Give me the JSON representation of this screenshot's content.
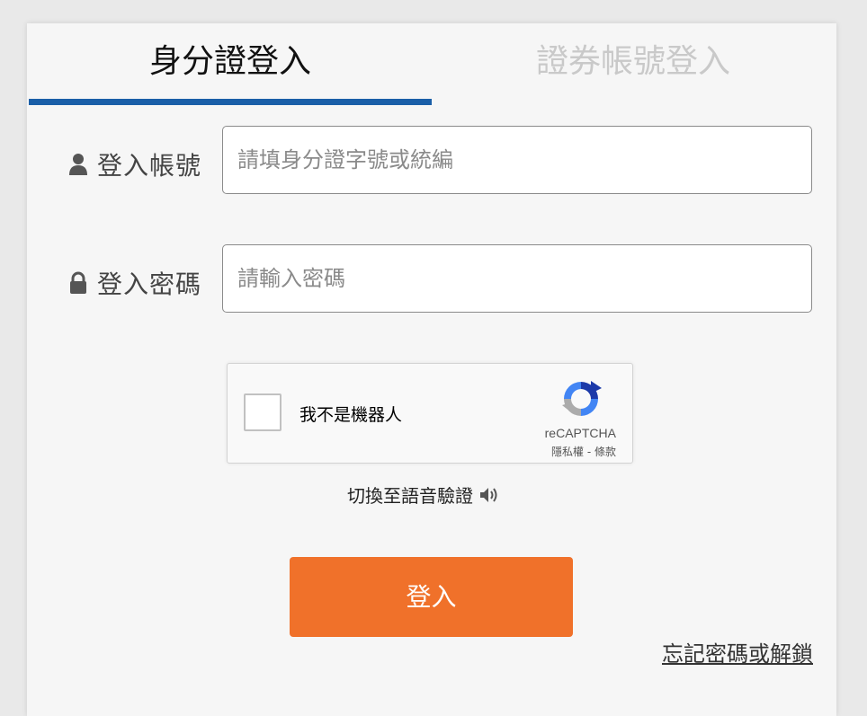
{
  "tabs": {
    "id_login": "身分證登入",
    "broker_login": "證券帳號登入"
  },
  "account": {
    "label": "登入帳號",
    "placeholder": "請填身分證字號或統編",
    "icon": "user-icon"
  },
  "password": {
    "label": "登入密碼",
    "placeholder": "請輸入密碼",
    "icon": "lock-icon"
  },
  "captcha": {
    "label": "我不是機器人",
    "brand": "reCAPTCHA",
    "terms": "隱私權 - 條款"
  },
  "audio": {
    "label": "切換至語音驗證",
    "icon": "speaker-icon"
  },
  "login_button": "登入",
  "forgot_link": "忘記密碼或解鎖",
  "colors": {
    "active_tab_underline": "#1a5fa8",
    "login_button": "#f0712a"
  }
}
